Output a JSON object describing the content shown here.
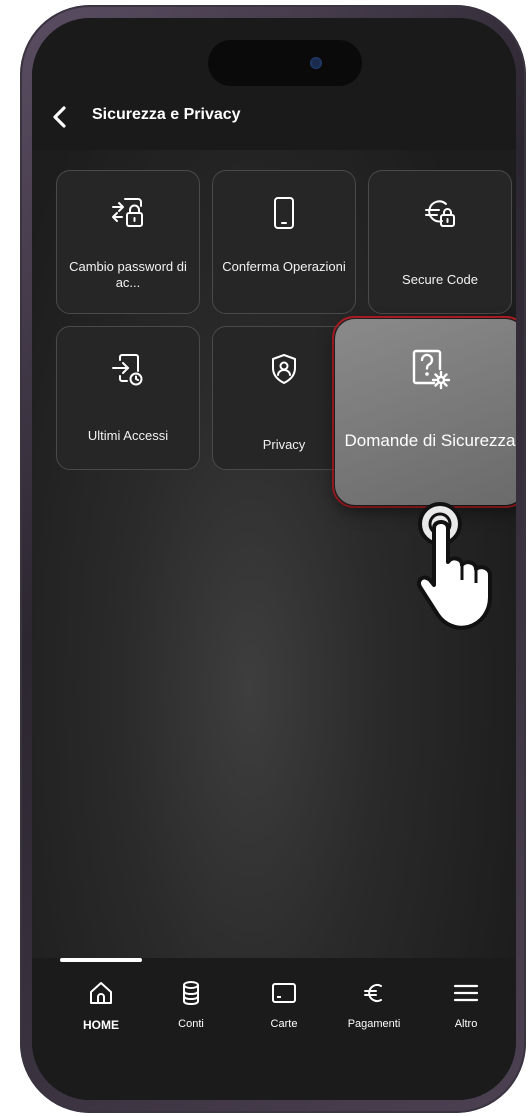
{
  "header": {
    "title": "Sicurezza e Privacy",
    "back_icon": "chevron-left-icon"
  },
  "tiles": [
    {
      "label": "Cambio password di ac...",
      "icon": "lock-swap-icon"
    },
    {
      "label": "Conferma Operazioni",
      "icon": "phone-icon"
    },
    {
      "label": "Secure Code",
      "icon": "euro-lock-icon"
    },
    {
      "label": "Ultimi Accessi",
      "icon": "login-clock-icon"
    },
    {
      "label": "Privacy",
      "icon": "shield-user-icon"
    }
  ],
  "highlighted_tile": {
    "label": "Domande di Sicurezza",
    "icon": "question-gear-icon",
    "highlight_color": "#b41e25"
  },
  "tabbar": {
    "items": [
      {
        "label": "HOME",
        "icon": "home-icon",
        "active": true
      },
      {
        "label": "Conti",
        "icon": "database-icon",
        "active": false
      },
      {
        "label": "Carte",
        "icon": "card-icon",
        "active": false
      },
      {
        "label": "Pagamenti",
        "icon": "euro-icon",
        "active": false
      },
      {
        "label": "Altro",
        "icon": "menu-icon",
        "active": false
      }
    ]
  }
}
